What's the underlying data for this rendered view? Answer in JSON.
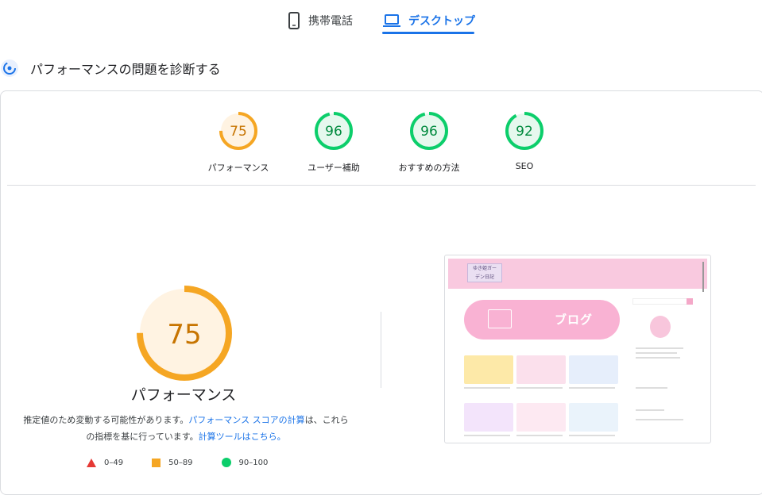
{
  "tabs": {
    "mobile_label": "携帯電話",
    "desktop_label": "デスクトップ"
  },
  "section": {
    "title": "パフォーマンスの問題を診断する"
  },
  "scores": [
    {
      "label": "パフォーマンス",
      "value": "75",
      "color": "#f5a623",
      "track": "#fff3e2",
      "fraction": 0.75
    },
    {
      "label": "ユーザー補助",
      "value": "96",
      "color": "#0cce6b",
      "track": "#e6f8ee",
      "fraction": 0.96
    },
    {
      "label": "おすすめの方法",
      "value": "96",
      "color": "#0cce6b",
      "track": "#e6f8ee",
      "fraction": 0.96
    },
    {
      "label": "SEO",
      "value": "92",
      "color": "#0cce6b",
      "track": "#e6f8ee",
      "fraction": 0.92
    }
  ],
  "main_gauge": {
    "value": "75",
    "label": "パフォーマンス",
    "fraction": 0.75
  },
  "description": {
    "part1": "推定値のため変動する可能性があります。",
    "link1": "パフォーマンス スコアの計算",
    "part2": "は、これらの指標を基に行っています。",
    "link2": "計算ツールはこちら。"
  },
  "legend": [
    {
      "range": "0–49",
      "shape": "triangle",
      "color": "#e53935"
    },
    {
      "range": "50–89",
      "shape": "square",
      "color": "#f5a623"
    },
    {
      "range": "90–100",
      "shape": "circle",
      "color": "#0cce6b"
    }
  ],
  "thumbnail": {
    "banner_text": "ブログ",
    "logo_text": "ゆき姫ガー\nデン日記"
  },
  "colors": {
    "accent": "#1a73e8",
    "average": "#f5a623",
    "pass": "#0cce6b",
    "fail": "#e53935"
  }
}
